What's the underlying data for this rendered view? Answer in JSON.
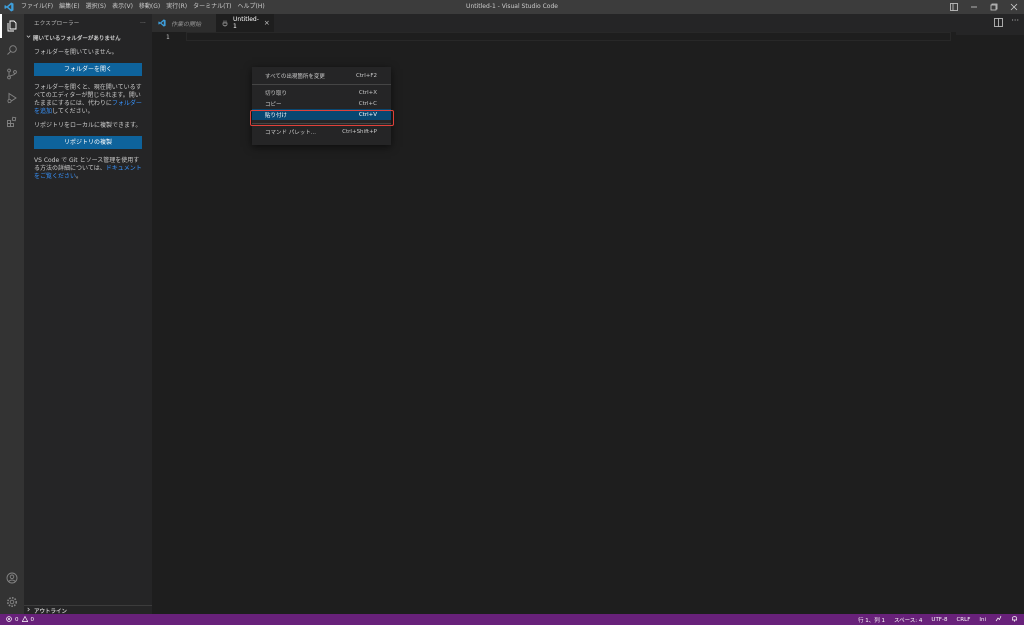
{
  "window": {
    "title": "Untitled-1 - Visual Studio Code"
  },
  "menu": [
    "ファイル(F)",
    "編集(E)",
    "選択(S)",
    "表示(V)",
    "移動(G)",
    "実行(R)",
    "ターミナル(T)",
    "ヘルプ(H)"
  ],
  "sidebar": {
    "header": "エクスプローラー",
    "more": "···",
    "section_title": "開いているフォルダーがありません",
    "no_folder_text": "フォルダーを開いていません。",
    "open_folder_button": "フォルダーを開く",
    "open_folder_desc_1": "フォルダーを開くと、現在開いているすべてのエディターが閉じられます。開いたままにするには、代わりに",
    "open_folder_desc_link": "フォルダーを追加",
    "open_folder_desc_2": "してください。",
    "clone_text": "リポジトリをローカルに複製できます。",
    "clone_button": "リポジトリの複製",
    "git_desc_1": "VS Code で Git とソース管理を使用する方法の詳細については、",
    "git_desc_link": "ドキュメントをご覧ください",
    "git_desc_2": "。",
    "outline": "アウトライン"
  },
  "tabs": [
    {
      "label": "作業の開始"
    },
    {
      "label": "Untitled-1",
      "close": "×"
    }
  ],
  "editor": {
    "line_number": "1"
  },
  "context_menu": [
    {
      "label": "すべての出現箇所を変更",
      "shortcut": "Ctrl+F2"
    },
    {
      "label": "切り取り",
      "shortcut": "Ctrl+X"
    },
    {
      "label": "コピー",
      "shortcut": "Ctrl+C"
    },
    {
      "label": "貼り付け",
      "shortcut": "Ctrl+V"
    },
    {
      "label": "コマンド パレット...",
      "shortcut": "Ctrl+Shift+P"
    }
  ],
  "statusbar": {
    "errors": "0",
    "warnings": "0",
    "position": "行 1、列 1",
    "spaces": "スペース: 4",
    "encoding": "UTF-8",
    "eol": "CRLF",
    "language": "Ini"
  },
  "colors": {
    "statusbar": "#68217a",
    "accent": "#0e639c",
    "highlight": "#e0413a"
  }
}
